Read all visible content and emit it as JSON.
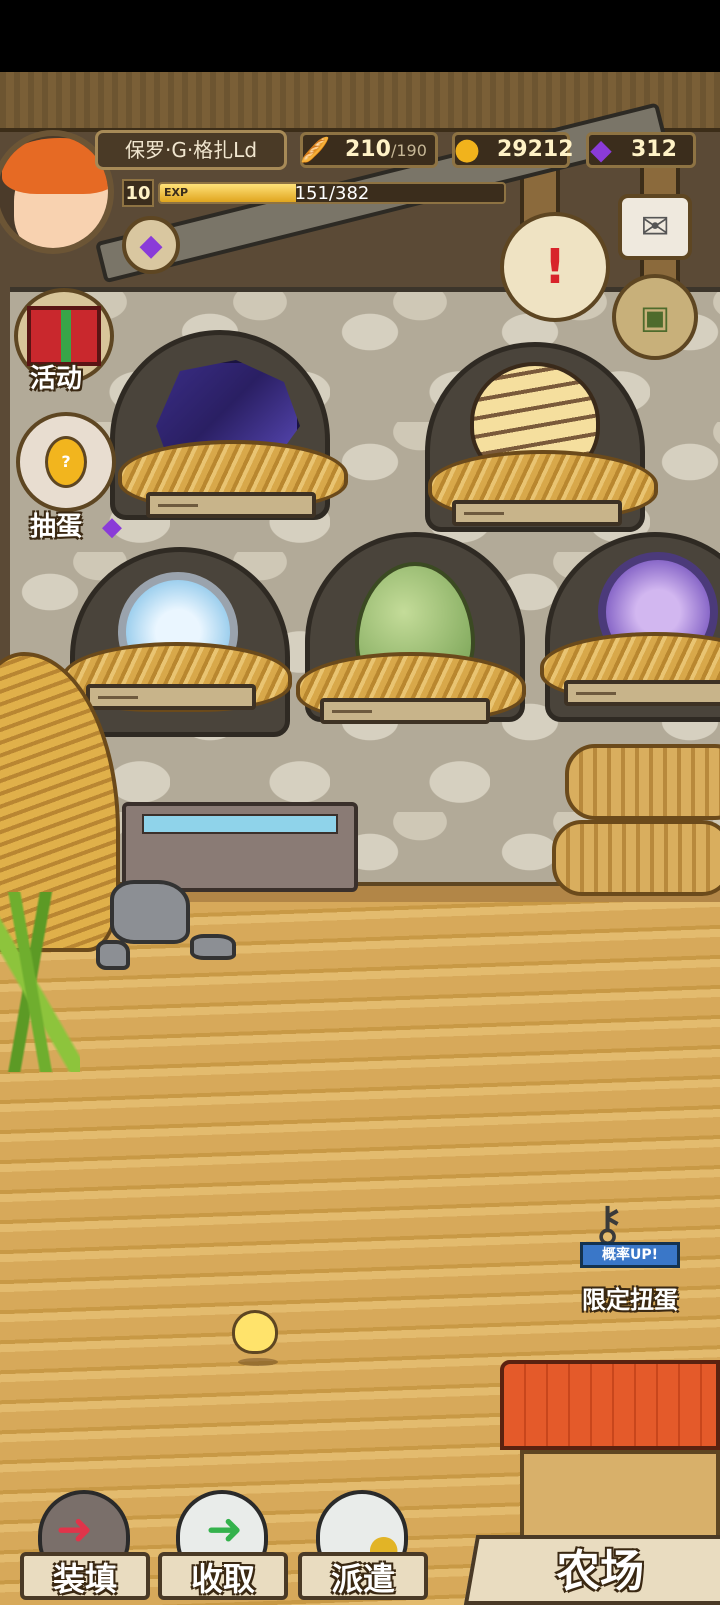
{
  "player": {
    "name": "保罗·G·格扎Ld",
    "level": "10",
    "exp_tag": "EXP",
    "exp_text": "151/382",
    "exp_fraction": 0.395
  },
  "resources": {
    "bread": {
      "value": "210",
      "max": "/190",
      "icon": "bread-icon"
    },
    "gold": {
      "value": "29212",
      "icon": "gold-coin-icon"
    },
    "gem": {
      "value": "312",
      "icon": "purple-gem-icon"
    }
  },
  "side_menu": {
    "activity_label": "活动",
    "gacha_label": "抽蛋"
  },
  "promo": {
    "badge": "概率UP!",
    "label": "限定扭蛋"
  },
  "bottom_bar": {
    "load_label": "装填",
    "collect_label": "收取",
    "dispatch_label": "派遣",
    "farm_label": "农场"
  },
  "nests": [
    {
      "egg": "crystal-egg"
    },
    {
      "egg": "tiger-egg"
    },
    {
      "egg": "silver-watch-egg"
    },
    {
      "egg": "green-egg"
    },
    {
      "egg": "purple-watch-egg"
    }
  ],
  "colors": {
    "accent_gold": "#e0a51e",
    "hud_dark": "#3b2d1c",
    "gem_purple": "#8a3bd8"
  }
}
